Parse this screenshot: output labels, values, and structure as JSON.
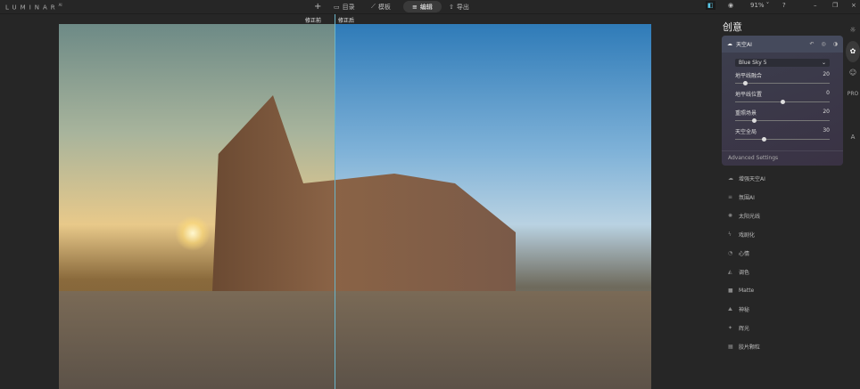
{
  "app": {
    "logo": "LUMINAR",
    "logo_sup": "AI"
  },
  "nav": {
    "add": "+",
    "items": [
      {
        "label": "目录",
        "icon": "folder-icon"
      },
      {
        "label": "模板",
        "icon": "wand-icon"
      },
      {
        "label": "编辑",
        "icon": "sliders-icon",
        "active": true
      },
      {
        "label": "导出",
        "icon": "export-icon"
      }
    ]
  },
  "toolbar": {
    "zoom": "91%"
  },
  "compare": {
    "before": "修正前",
    "after": "修正后"
  },
  "panel": {
    "title": "创意",
    "tool": {
      "name": "天空AI",
      "preset": "Blue Sky 5",
      "sliders": [
        {
          "label": "地平线融合",
          "value": 20
        },
        {
          "label": "地平线位置",
          "value": 0
        },
        {
          "label": "重照场景",
          "value": 20
        },
        {
          "label": "天空全局",
          "value": 30
        }
      ],
      "advanced": "Advanced Settings"
    },
    "tools": [
      "增强天空AI",
      "氛围AI",
      "太阳光线",
      "戏剧化",
      "心情",
      "调色",
      "Matte",
      "神秘",
      "辉光",
      "胶片颗粒"
    ]
  },
  "rail": [
    "sun-icon",
    "palette-icon",
    "face-icon",
    "PRO",
    "A"
  ],
  "colors": {
    "accent": "#6ab4c8",
    "card": "#3c3f4e"
  }
}
